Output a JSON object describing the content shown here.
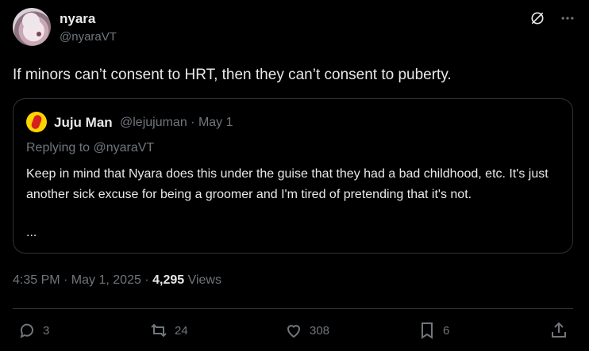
{
  "tweet": {
    "author_name": "nyara",
    "author_handle": "@nyaraVT",
    "text": "If minors can’t consent to HRT, then they can’t consent to puberty.",
    "timestamp": "4:35 PM · May 1, 2025 ·",
    "views_count": "4,295",
    "views_label": "Views"
  },
  "quote": {
    "author_name": "Juju Man",
    "author_handle_date": "@lejujuman · May 1",
    "replying_to": "Replying to @nyaraVT",
    "body": "Keep in mind that Nyara does this under the guise that they had a bad childhood, etc. It's just another sick excuse for being a groomer and I'm tired of pretending that it's not.",
    "ellipsis": "..."
  },
  "actions": {
    "replies": "3",
    "retweets": "24",
    "likes": "308",
    "bookmarks": "6"
  },
  "icons": [
    "grok-icon",
    "more-icon",
    "reply-icon",
    "retweet-icon",
    "like-icon",
    "bookmark-icon",
    "share-icon"
  ],
  "colors": {
    "background": "#000000",
    "text": "#e7e9ea",
    "muted": "#71767b",
    "border": "#2f3336"
  }
}
